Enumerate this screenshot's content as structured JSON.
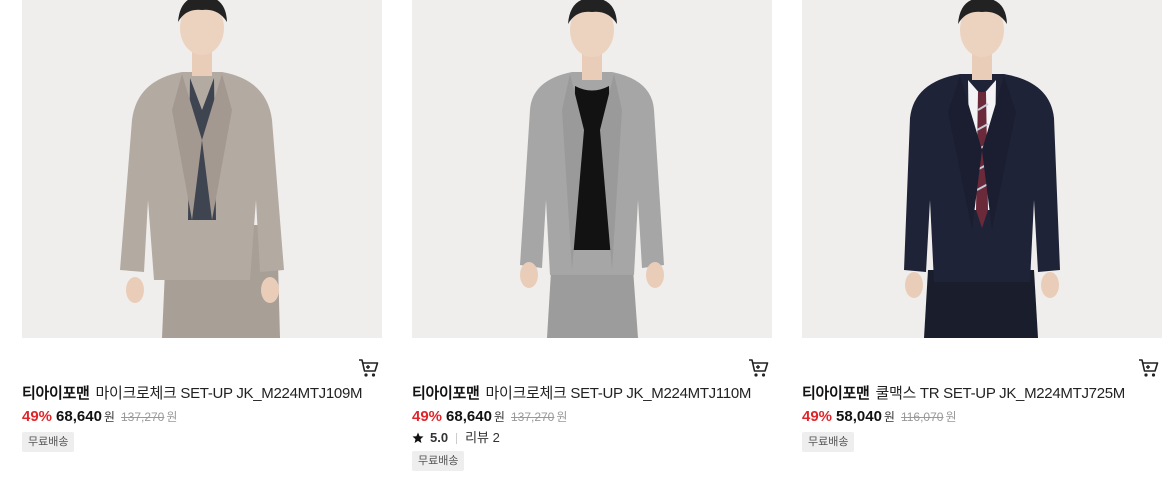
{
  "products": [
    {
      "brand": "티아이포맨",
      "name": "마이크로체크 SET-UP JK_M224MTJ109M",
      "discount": "49%",
      "price": "68,640",
      "currency": "원",
      "original_price": "137,270",
      "original_currency": "원",
      "badge": "무료배송",
      "jacket_color": "#b3aaa2",
      "shirt_color": "#3e4450"
    },
    {
      "brand": "티아이포맨",
      "name": "마이크로체크 SET-UP JK_M224MTJ110M",
      "discount": "49%",
      "price": "68,640",
      "currency": "원",
      "original_price": "137,270",
      "original_currency": "원",
      "rating": "5.0",
      "review": "리뷰 2",
      "badge": "무료배송",
      "jacket_color": "#a6a6a6",
      "shirt_color": "#121212"
    },
    {
      "brand": "티아이포맨",
      "name": "쿨맥스 TR SET-UP JK_M224MTJ725M",
      "discount": "49%",
      "price": "58,040",
      "currency": "원",
      "original_price": "116,070",
      "original_currency": "원",
      "badge": "무료배송",
      "jacket_color": "#1f2337",
      "shirt_color": "#f4f4f6"
    }
  ],
  "icons": {
    "cart": "cart-icon",
    "star": "star-icon"
  },
  "colors": {
    "discount": "#e0252a",
    "badge_bg": "#eeeeee"
  }
}
